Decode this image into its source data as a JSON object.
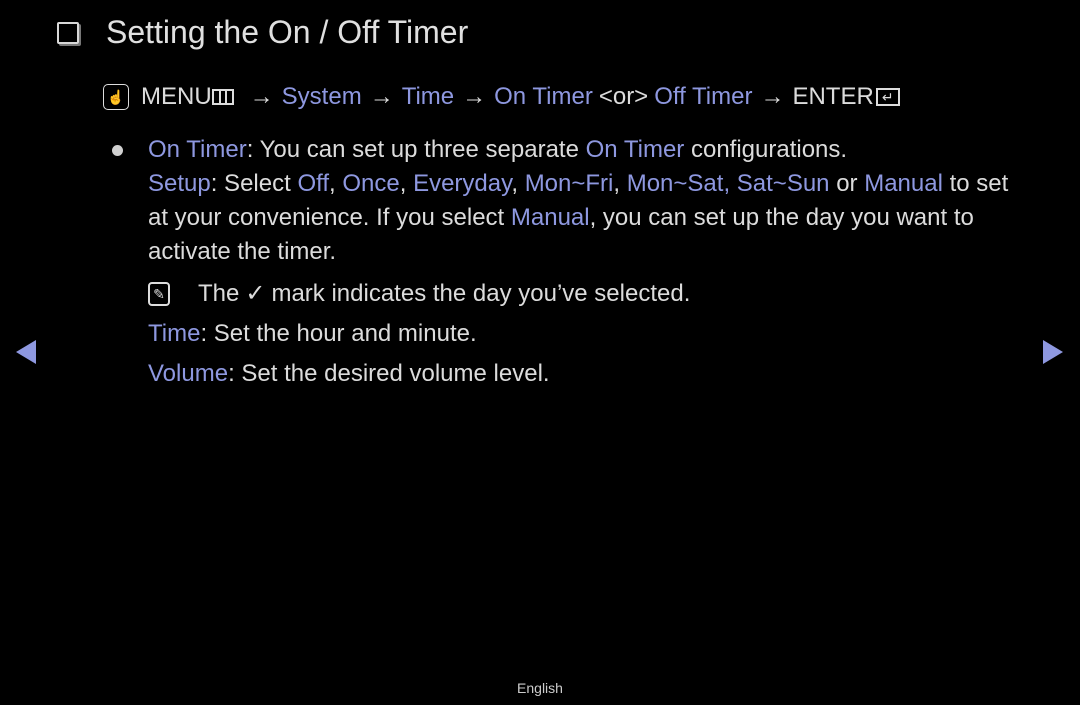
{
  "title": "Setting the On / Off Timer",
  "path": {
    "menu": "MENU",
    "steps": [
      "System",
      "Time",
      "On Timer"
    ],
    "or_label": "<or>",
    "alt_step": "Off Timer",
    "enter": "ENTER",
    "arrow": "→"
  },
  "on_timer": {
    "label": "On Timer",
    "text1": ": You can set up three separate ",
    "label2": "On Timer",
    "text2": " configurations."
  },
  "setup": {
    "label": "Setup",
    "text_select": ": Select ",
    "options": [
      "Off",
      "Once",
      "Everyday",
      "Mon~Fri",
      "Mon~Sat, Sat~Sun"
    ],
    "text_or": " or",
    "manual": "Manual",
    "text_conv": " to set at your convenience. If you select ",
    "manual2": "Manual",
    "text_end": ", you can set up the day you want to activate the timer."
  },
  "note": {
    "text_the": "The",
    "check": "✓",
    "text_rest": "mark indicates the day you’ve selected."
  },
  "time": {
    "label": "Time",
    "text": ": Set the hour and minute."
  },
  "volume": {
    "label": "Volume",
    "text": ": Set the desired volume level."
  },
  "footer": "English",
  "colors": {
    "accent": "#8e98e0",
    "text": "#dcdcdc",
    "background": "#000000"
  }
}
